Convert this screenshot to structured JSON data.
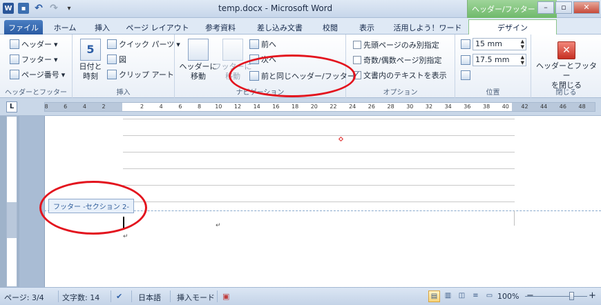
{
  "window": {
    "title": "temp.docx - Microsoft Word",
    "context_tab_header": "ヘッダー/フッター ツ..."
  },
  "quick_access": {
    "word_icon": "W",
    "icons": [
      "word-icon",
      "save-icon",
      "undo-icon",
      "redo-icon",
      "customize-dropdown-icon"
    ]
  },
  "tabs": [
    "ファイル",
    "ホーム",
    "挿入",
    "ページ レイアウト",
    "参考資料",
    "差し込み文書",
    "校閲",
    "表示",
    "活用しよう！ワード",
    "デザイン"
  ],
  "ribbon": {
    "header_footer_group": {
      "label": "ヘッダーとフッター",
      "header": "ヘッダー",
      "footer": "フッター",
      "page_number": "ページ番号"
    },
    "insert_group": {
      "label": "挿入",
      "date_time": "日付と時刻",
      "date_time_line1": "日付と",
      "date_time_line2": "時刻",
      "quick_parts": "クイック パーツ",
      "picture": "図",
      "clip_art": "クリップ アート"
    },
    "navigation_group": {
      "label": "ナビゲーション",
      "goto_header_line1": "ヘッダーに",
      "goto_header_line2": "移動",
      "goto_footer_line1": "フッターに",
      "goto_footer_line2": "移動",
      "previous": "前へ",
      "next": "次へ",
      "link_to_previous": "前と同じヘッダー/フッター"
    },
    "options_group": {
      "label": "オプション",
      "different_first_page": "先頭ページのみ別指定",
      "different_odd_even": "奇数/偶数ページ別指定",
      "show_document_text": "文書内のテキストを表示",
      "different_first_page_checked": false,
      "different_odd_even_checked": false,
      "show_document_text_checked": true
    },
    "position_group": {
      "label": "位置",
      "header_from_top": "15 mm",
      "footer_from_bottom": "17.5 mm"
    },
    "close_group": {
      "label": "閉じる",
      "close_line1": "ヘッダーとフッター",
      "close_line2": "を閉じる"
    }
  },
  "ruler": {
    "corner": "L",
    "ticks": [
      "8",
      "6",
      "4",
      "2",
      "",
      "2",
      "4",
      "6",
      "8",
      "10",
      "12",
      "14",
      "16",
      "18",
      "20",
      "22",
      "24",
      "26",
      "28",
      "30",
      "32",
      "34",
      "36",
      "38",
      "40",
      "42",
      "44",
      "46",
      "48"
    ]
  },
  "document": {
    "footer_tag": "フッター -セクション 2-",
    "paragraph_mark": "↵"
  },
  "statusbar": {
    "page": "ページ: 3/4",
    "word_count": "文字数: 14",
    "language": "日本語",
    "insert_mode": "挿入モード",
    "zoom": "100%"
  }
}
